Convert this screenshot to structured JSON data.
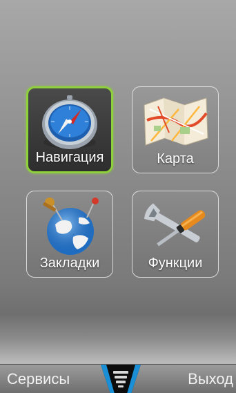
{
  "menu": {
    "items": [
      {
        "label": "Навигация",
        "icon": "compass-icon",
        "selected": true
      },
      {
        "label": "Карта",
        "icon": "map-icon",
        "selected": false
      },
      {
        "label": "Закладки",
        "icon": "globe-pins-icon",
        "selected": false
      },
      {
        "label": "Функции",
        "icon": "tools-icon",
        "selected": false
      }
    ]
  },
  "softkeys": {
    "left_label": "Сервисы",
    "right_label": "Выход",
    "center_icon": "menu-icon"
  },
  "colors": {
    "selection": "#8ed13a",
    "center_button": "#1a8fd6"
  }
}
